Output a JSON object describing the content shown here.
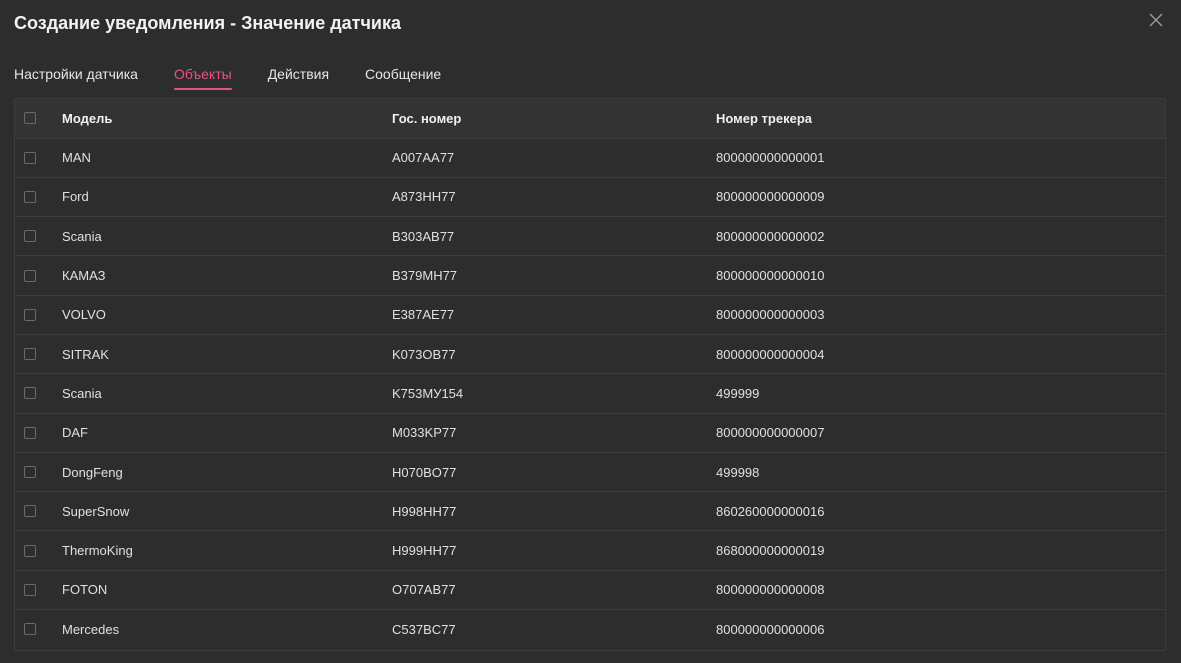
{
  "dialog": {
    "title": "Создание уведомления - Значение датчика",
    "close_icon": "close-icon"
  },
  "tabs": [
    {
      "label": "Настройки датчика",
      "active": false
    },
    {
      "label": "Объекты",
      "active": true
    },
    {
      "label": "Действия",
      "active": false
    },
    {
      "label": "Сообщение",
      "active": false
    }
  ],
  "colors": {
    "accent": "#e8508c",
    "background": "#2d2d2d",
    "header_bg": "#333333"
  },
  "table": {
    "headers": {
      "model": "Модель",
      "plate": "Гос. номер",
      "tracker": "Номер трекера"
    },
    "rows": [
      {
        "model": "MAN",
        "plate": "A007AA77",
        "tracker": "800000000000001"
      },
      {
        "model": "Ford",
        "plate": "A873HH77",
        "tracker": "800000000000009"
      },
      {
        "model": "Scania",
        "plate": "B303AB77",
        "tracker": "800000000000002"
      },
      {
        "model": "КАМАЗ",
        "plate": "B379MH77",
        "tracker": "800000000000010"
      },
      {
        "model": "VOLVO",
        "plate": "E387AE77",
        "tracker": "800000000000003"
      },
      {
        "model": "SITRAK",
        "plate": "K073OB77",
        "tracker": "800000000000004"
      },
      {
        "model": "Scania",
        "plate": "K753МУ154",
        "tracker": "499999"
      },
      {
        "model": "DAF",
        "plate": "M033KP77",
        "tracker": "800000000000007"
      },
      {
        "model": "DongFeng",
        "plate": "H070BO77",
        "tracker": "499998"
      },
      {
        "model": "SuperSnow",
        "plate": "H998HH77",
        "tracker": "860260000000016"
      },
      {
        "model": "ThermoKing",
        "plate": "H999HH77",
        "tracker": "868000000000019"
      },
      {
        "model": "FOTON",
        "plate": "O707AB77",
        "tracker": "800000000000008"
      },
      {
        "model": "Mercedes",
        "plate": "C537BC77",
        "tracker": "800000000000006"
      }
    ]
  }
}
